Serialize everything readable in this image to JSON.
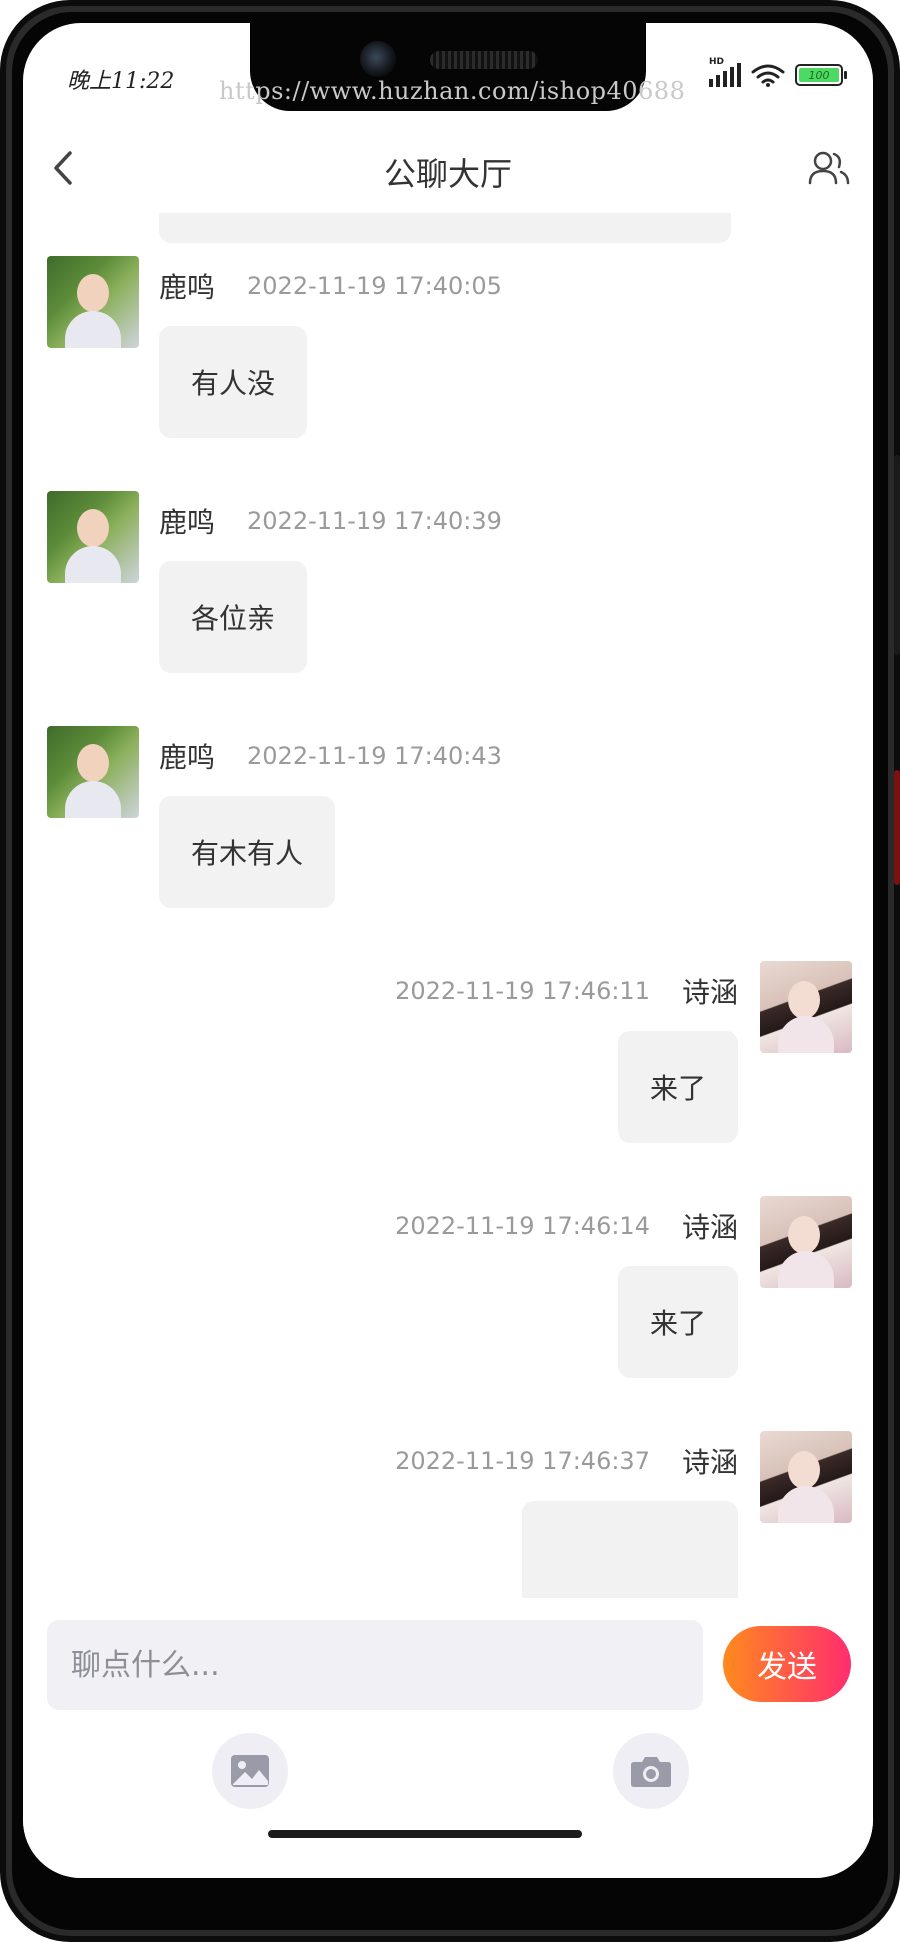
{
  "status_bar": {
    "time": "晚上11:22",
    "network": "HD",
    "battery": "100"
  },
  "watermark": "https://www.huzhan.com/ishop40688",
  "header": {
    "title": "公聊大厅"
  },
  "messages": [
    {
      "side": "left",
      "name": "鹿鸣",
      "time": "2022-11-19 17:40:05",
      "text": "有人没"
    },
    {
      "side": "left",
      "name": "鹿鸣",
      "time": "2022-11-19 17:40:39",
      "text": "各位亲"
    },
    {
      "side": "left",
      "name": "鹿鸣",
      "time": "2022-11-19 17:40:43",
      "text": "有木有人"
    },
    {
      "side": "right",
      "name": "诗涵",
      "time": "2022-11-19 17:46:11",
      "text": "来了"
    },
    {
      "side": "right",
      "name": "诗涵",
      "time": "2022-11-19 17:46:14",
      "text": "来了"
    },
    {
      "side": "right",
      "name": "诗涵",
      "time": "2022-11-19 17:46:37",
      "text": ""
    }
  ],
  "composer": {
    "placeholder": "聊点什么...",
    "send_label": "发送"
  },
  "colors": {
    "send_gradient_start": "#ff8a1d",
    "send_gradient_end": "#ff2d6f",
    "bubble": "#f2f2f2",
    "input_bg": "#f0f0f5"
  }
}
